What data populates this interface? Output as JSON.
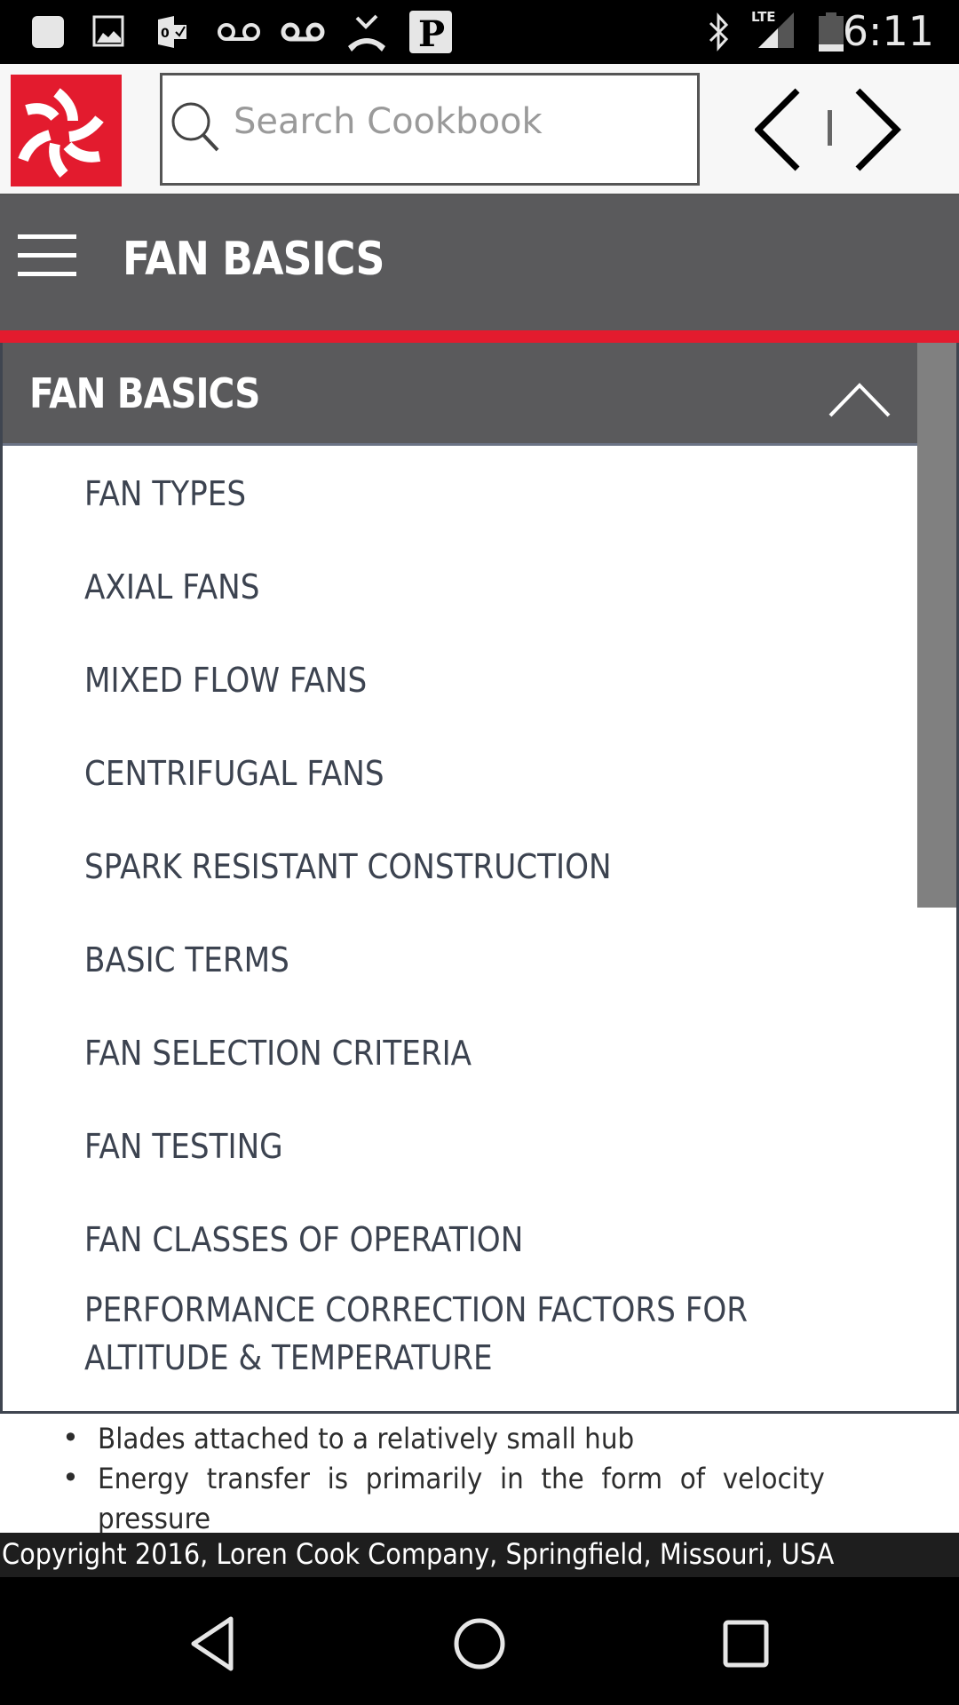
{
  "status_bar": {
    "time": "6:11",
    "network_label": "LTE",
    "left_icons": [
      "app-notification-icon",
      "image-icon",
      "outlook-icon",
      "voicemail-icon",
      "voicemail-icon",
      "missed-call-icon",
      "parking-icon"
    ],
    "right_icons": [
      "bluetooth-icon",
      "signal-icon",
      "battery-icon"
    ]
  },
  "top_bar": {
    "logo": "loren-cook-logo",
    "search": {
      "placeholder": "Search Cookbook",
      "value": ""
    },
    "nav": {
      "prev": "previous-page",
      "next": "next-page"
    }
  },
  "header": {
    "title": "FAN BASICS",
    "menu_icon": "hamburger-menu-icon",
    "accent_color": "#e31b2e"
  },
  "panel": {
    "title": "FAN BASICS",
    "expanded": true,
    "items": [
      {
        "label": "FAN TYPES"
      },
      {
        "label": "AXIAL FANS"
      },
      {
        "label": "MIXED FLOW FANS"
      },
      {
        "label": "CENTRIFUGAL FANS"
      },
      {
        "label": "SPARK RESISTANT CONSTRUCTION"
      },
      {
        "label": "BASIC TERMS"
      },
      {
        "label": "FAN SELECTION CRITERIA"
      },
      {
        "label": "FAN TESTING"
      },
      {
        "label": "FAN CLASSES OF OPERATION"
      },
      {
        "label": "PERFORMANCE CORRECTION FACTORS FOR ALTITUDE & TEMPERATURE"
      }
    ]
  },
  "content": {
    "bullets": [
      "Blades attached to a relatively small hub",
      "Energy transfer is primarily in the form of velocity pressure"
    ]
  },
  "footer": {
    "copyright": "Copyright 2016, Loren Cook Company, Springfield, Missouri, USA"
  },
  "nav_bar": {
    "buttons": [
      "back",
      "home",
      "recents"
    ]
  }
}
